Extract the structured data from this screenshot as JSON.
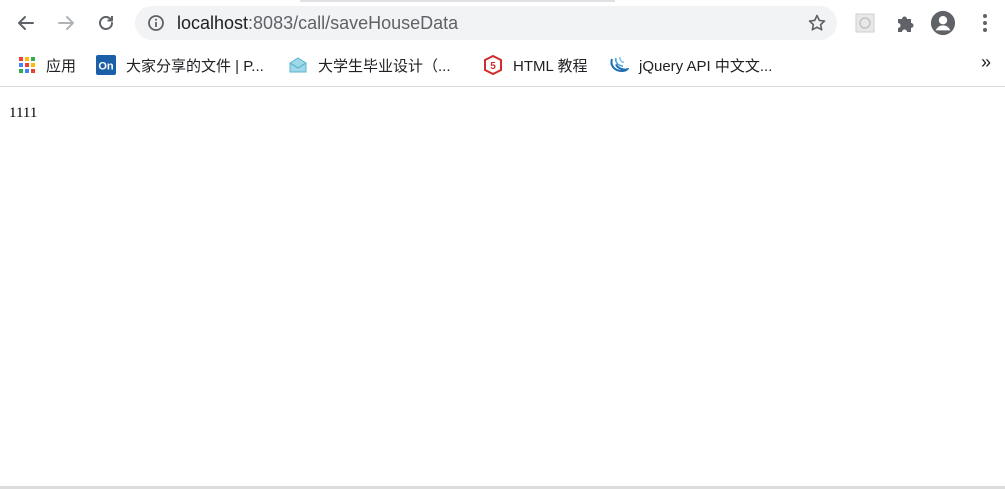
{
  "browser": {
    "url": {
      "host": "localhost",
      "path": ":8083/call/saveHouseData"
    },
    "nav": {
      "back": "back-icon",
      "forward": "forward-icon",
      "reload": "reload-icon"
    },
    "toolbar_icons": [
      "site-info-icon",
      "bookmark-star-icon",
      "extension-tile-icon",
      "extensions-puzzle-icon",
      "profile-avatar-icon",
      "menu-kebab-icon"
    ]
  },
  "bookmarks": {
    "items": [
      {
        "label": "应用",
        "icon": "apps-grid-icon"
      },
      {
        "label": "大家分享的文件 | P...",
        "icon": "processon-icon"
      },
      {
        "label": "大学生毕业设计（...",
        "icon": "graduation-icon"
      },
      {
        "label": "HTML 教程",
        "icon": "html5-icon"
      },
      {
        "label": "jQuery API 中文文...",
        "icon": "jquery-icon"
      }
    ],
    "overflow": "»"
  },
  "page": {
    "text": "1111"
  },
  "colors": {
    "omnibox_bg": "#f1f3f4",
    "icon": "#5f6368",
    "text": "#202124",
    "html5_red": "#d12b2b",
    "processon_blue": "#1a5fa8",
    "jquery_blue": "#1f6fb5"
  }
}
